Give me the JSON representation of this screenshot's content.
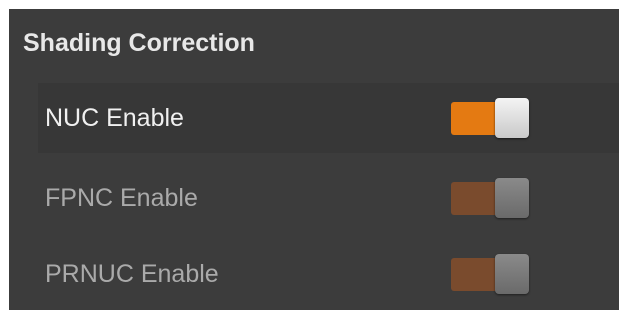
{
  "section": {
    "title": "Shading Correction"
  },
  "rows": [
    {
      "label": "NUC Enable",
      "enabled": true,
      "toggle_on": true
    },
    {
      "label": "FPNC Enable",
      "enabled": false,
      "toggle_on": true
    },
    {
      "label": "PRNUC Enable",
      "enabled": false,
      "toggle_on": true
    }
  ],
  "colors": {
    "panel_bg": "#3c3c3c",
    "accent_orange": "#e47a12",
    "disabled_orange": "#7a4b2d"
  }
}
